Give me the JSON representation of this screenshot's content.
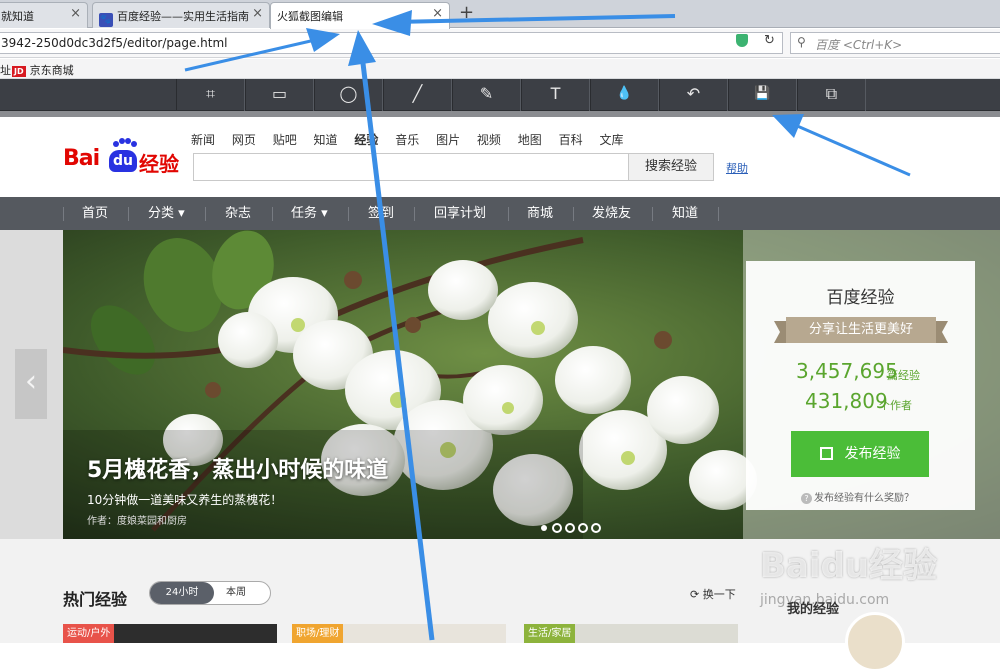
{
  "browser": {
    "tabs": [
      {
        "label": "就知道"
      },
      {
        "label": "百度经验——实用生活指南"
      },
      {
        "label": "火狐截图编辑"
      }
    ],
    "new_tab": "+",
    "close_glyph": "×",
    "url": "3942-250d0dc3d2f5/editor/page.html",
    "search_placeholder": "百度 <Ctrl+K>",
    "bookmarks": [
      {
        "label": "址"
      },
      {
        "label": "京东商城",
        "icon_text": "JD"
      }
    ]
  },
  "editor_toolbar": {
    "tools": [
      {
        "name": "crop-icon",
        "glyph": "⌗"
      },
      {
        "name": "rectangle-icon",
        "glyph": "▭"
      },
      {
        "name": "ellipse-icon",
        "glyph": "◯"
      },
      {
        "name": "line-icon",
        "glyph": "╱"
      },
      {
        "name": "pen-icon",
        "glyph": "✎"
      },
      {
        "name": "text-icon",
        "glyph": "T"
      },
      {
        "name": "blur-icon",
        "glyph": "💧"
      },
      {
        "name": "undo-icon",
        "glyph": "↶"
      },
      {
        "name": "save-icon",
        "glyph": "💾"
      },
      {
        "name": "copy-icon",
        "glyph": "⧉"
      }
    ]
  },
  "baidu": {
    "logo": {
      "bai": "Bai",
      "du": "du",
      "jingyan": "经验"
    },
    "top_nav": [
      "新闻",
      "网页",
      "贴吧",
      "知道",
      "经验",
      "音乐",
      "图片",
      "视频",
      "地图",
      "百科",
      "文库"
    ],
    "search_button": "搜索经验",
    "help": "帮助",
    "main_nav": [
      "首页",
      "分类 ▾",
      "杂志",
      "任务 ▾",
      "签到",
      "回享计划",
      "商城",
      "发烧友",
      "知道"
    ],
    "hero": {
      "title": "5月槐花香，蒸出小时候的味道",
      "subtitle": "10分钟做一道美味又养生的蒸槐花！",
      "author": "作者：度娘菜园和厨房",
      "prev_glyph": "‹"
    },
    "stats_card": {
      "title": "百度经验",
      "slogan": "分享让生活更美好",
      "experiences_count": "3,457,695",
      "experiences_unit": "篇经验",
      "authors_count": "431,809",
      "authors_unit": "个作者",
      "publish_button": "发布经验",
      "reward_link": "发布经验有什么奖励？"
    },
    "hot": {
      "title": "热门经验",
      "range_on": "24小时",
      "range_off": "本周",
      "refresh": "换一下",
      "my_experience": "我的经验",
      "categories": [
        "运动/户外",
        "职场/理财",
        "生活/家居"
      ]
    },
    "watermark": {
      "text": "Baidu经验",
      "url": "jingyan.baidu.com"
    }
  },
  "colors": {
    "accent_green": "#4bbd38",
    "stat_green": "#5aa52e",
    "annotation_arrow": "#3a8ee6",
    "toolbar_bg": "#3c3f45",
    "nav_bg": "#55595f"
  }
}
